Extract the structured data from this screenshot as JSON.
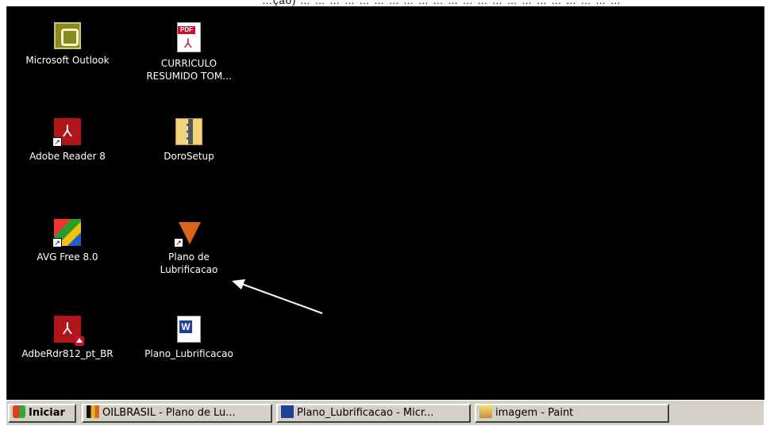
{
  "top_caption": "…ção) … … … … … … … … … … … … … … … … … … … … … …",
  "desktop_icons": [
    {
      "label": "Microsoft Outlook",
      "icon": "outlook-icon"
    },
    {
      "label": "CURRICULO RESUMIDO TOM...",
      "icon": "pdf-document-icon"
    },
    {
      "label": "Adobe Reader 8",
      "icon": "adobe-reader-icon",
      "shortcut": true
    },
    {
      "label": "DoroSetup",
      "icon": "zip-folder-icon"
    },
    {
      "label": "AVG Free 8.0",
      "icon": "avg-icon",
      "shortcut": true
    },
    {
      "label": "Plano de Lubrificacao",
      "icon": "fox-app-icon",
      "shortcut": true
    },
    {
      "label": "AdbeRdr812_pt_BR",
      "icon": "adobe-installer-icon"
    },
    {
      "label": "Plano_Lubrificacao",
      "icon": "word-document-icon"
    }
  ],
  "taskbar": {
    "start_label": "Iniciar",
    "items": [
      {
        "label": "OILBRASIL - Plano de Lu...",
        "icon": "oilbrasil-icon"
      },
      {
        "label": "Plano_Lubrificacao - Micr...",
        "icon": "word-icon"
      },
      {
        "label": "imagem - Paint",
        "icon": "paint-icon"
      }
    ]
  },
  "colors": {
    "desktop_background": "#000000",
    "taskbar_background": "#d4d0c8",
    "icon_label": "#ffffff"
  }
}
